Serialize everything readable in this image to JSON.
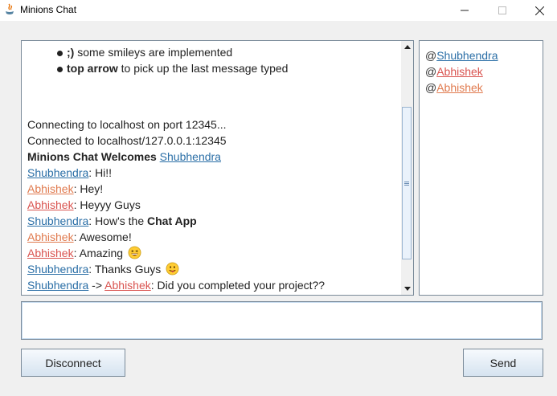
{
  "window": {
    "title": "Minions Chat"
  },
  "chat": {
    "tips": [
      {
        "bold": ";)",
        "text": " some smileys are implemented"
      },
      {
        "bold": "top arrow",
        "text": " to pick up the last message typed"
      }
    ],
    "status": [
      "Connecting to localhost on port 12345...",
      "Connected to localhost/127.0.0.1:12345"
    ],
    "welcome": {
      "text": "Minions Chat Welcomes ",
      "user": "Shubhendra"
    },
    "messages": [
      {
        "user": "Shubhendra",
        "text": ": Hi!!"
      },
      {
        "user": "Abhishek",
        "text": ": Hey!"
      },
      {
        "user": "Abhishek",
        "text": ": Heyyy Guys"
      },
      {
        "user": "Shubhendra",
        "text": ": How's the ",
        "bold": "Chat App"
      },
      {
        "user": "Abhishek",
        "text": ": Awesome!"
      },
      {
        "user": "Abhishek",
        "text": ": Amazing"
      },
      {
        "user": "Shubhendra",
        "text": ": Thanks Guys"
      },
      {
        "user": "Shubhendra",
        "arrow": " -> ",
        "to": "Abhishek",
        "text": ": Did you completed your project??"
      }
    ]
  },
  "users": [
    "@",
    "Shubhendra",
    "Abhishek",
    "Abhishek"
  ],
  "input": {
    "value": ""
  },
  "buttons": {
    "disconnect": "Disconnect",
    "send": "Send"
  },
  "icons": {
    "app": "java-icon",
    "smiley_grin": "grinning-face-icon",
    "smiley_tongue": "tongue-face-icon"
  },
  "colors": {
    "user_blue": "#2a6ea6",
    "user_orange": "#e07a4e",
    "user_red": "#d9534f"
  }
}
